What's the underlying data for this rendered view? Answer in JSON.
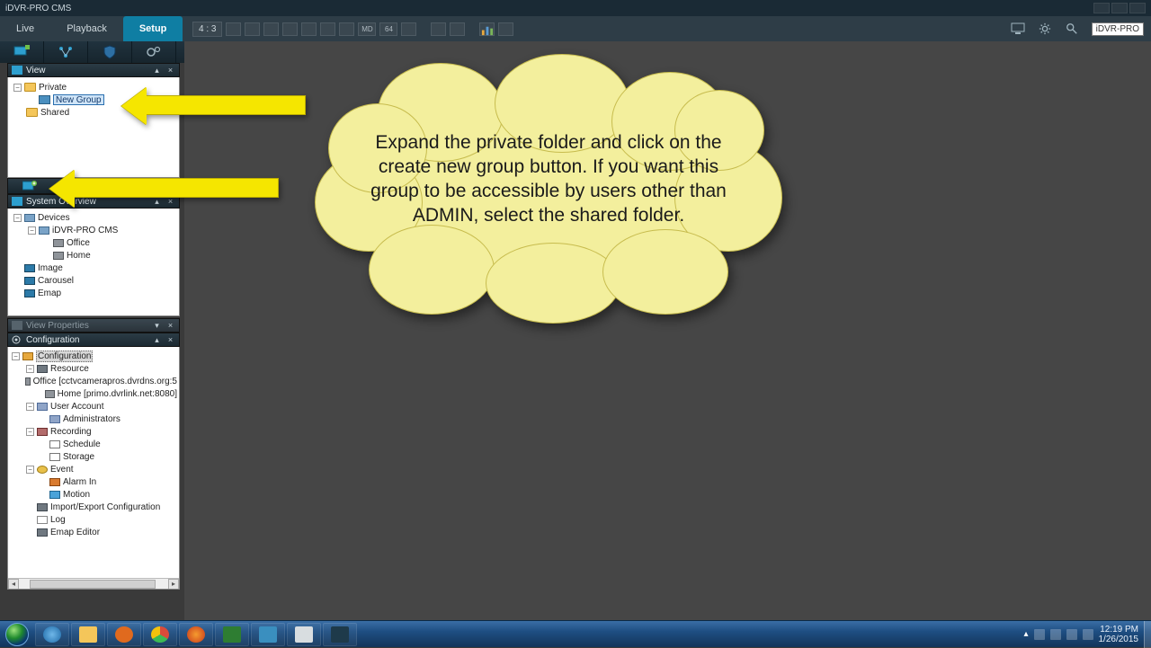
{
  "app": {
    "title": "iDVR-PRO CMS",
    "badge": "iDVR-PRO"
  },
  "tabs": {
    "live": "Live",
    "playback": "Playback",
    "setup": "Setup"
  },
  "ratiobar": {
    "ratio": "4 : 3",
    "md": "MD",
    "x64": "64"
  },
  "panels": {
    "view": {
      "title": "View"
    },
    "system_overview": {
      "title": "System Overview"
    },
    "view_properties": {
      "title": "View Properties"
    },
    "configuration": {
      "title": "Configuration"
    }
  },
  "view_tree": {
    "private": "Private",
    "new_group": "New Group",
    "shared": "Shared"
  },
  "system_tree": {
    "devices": "Devices",
    "idvr": "iDVR-PRO CMS",
    "office": "Office",
    "home": "Home",
    "image": "Image",
    "carousel": "Carousel",
    "emap": "Emap"
  },
  "config_tree": {
    "root": "Configuration",
    "resource": "Resource",
    "office": "Office [cctvcamerapros.dvrdns.org:5",
    "home": "Home [primo.dvrlink.net:8080]",
    "user_account": "User Account",
    "administrators": "Administrators",
    "recording": "Recording",
    "schedule": "Schedule",
    "storage": "Storage",
    "event": "Event",
    "alarm_in": "Alarm In",
    "motion": "Motion",
    "import_export": "Import/Export Configuration",
    "log": "Log",
    "emap_editor": "Emap Editor"
  },
  "callout": {
    "text": "Expand the private folder and click on the create new group button. If you want this group to be accessible by users other than ADMIN, select the shared folder."
  },
  "taskbar": {
    "time": "12:19 PM",
    "date": "1/26/2015"
  }
}
